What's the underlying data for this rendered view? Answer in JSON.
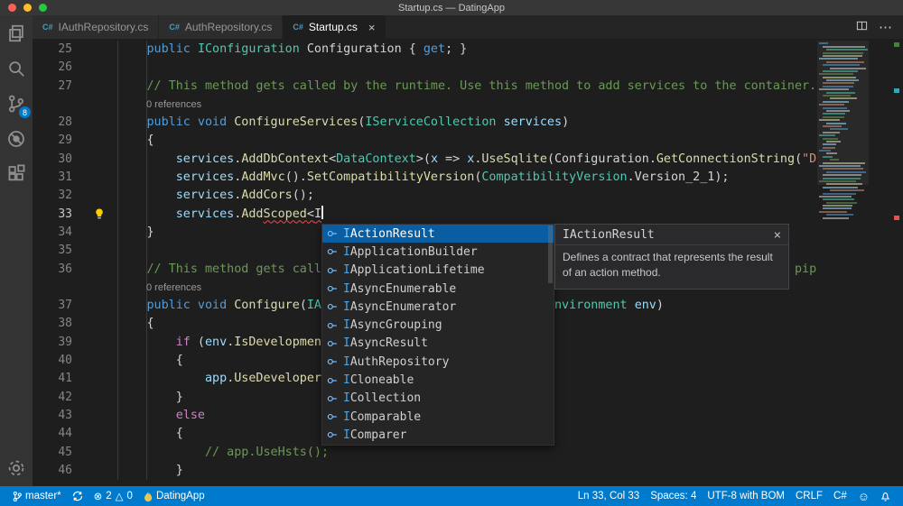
{
  "theme": {
    "accent": "#007acc",
    "editor_bg": "#1e1e1e",
    "panel_bg": "#252526",
    "titlebar_bg": "#373737",
    "activitybar_bg": "#333333",
    "tab_inactive_bg": "#2d2d2d",
    "tab_active_bg": "#1e1e1e",
    "statusbar_bg": "#007acc",
    "error_red": "#f14c4c",
    "selection_blue": "#0b5da2",
    "syn_kw": "#569cd6",
    "syn_type": "#4ec9b0",
    "syn_fn": "#dcdcaa",
    "syn_var": "#9cdcfe",
    "syn_str": "#ce9178",
    "syn_com": "#6a9955",
    "syn_ctrl": "#c586c0",
    "syn_pl": "#d4d4d4"
  },
  "titlebar": {
    "title": "Startup.cs — DatingApp"
  },
  "activity_bar": {
    "scm_badge": "8"
  },
  "tabs": [
    {
      "label": "IAuthRepository.cs",
      "icon": "C#",
      "active": false
    },
    {
      "label": "AuthRepository.cs",
      "icon": "C#",
      "active": false
    },
    {
      "label": "Startup.cs",
      "icon": "C#",
      "active": true,
      "close": "×"
    }
  ],
  "tab_actions": {
    "more": "⋯"
  },
  "editor": {
    "codelens_label": "0 references",
    "rows": [
      {
        "n": "25",
        "segs": [
          [
            "kw",
            "        public "
          ],
          [
            "type",
            "IConfiguration"
          ],
          [
            "pl",
            " Configuration { "
          ],
          [
            "kw",
            "get"
          ],
          [
            "pl",
            "; }"
          ]
        ]
      },
      {
        "n": "26",
        "segs": []
      },
      {
        "n": "27",
        "segs": [
          [
            "com",
            "        // This method gets called by the runtime. Use this method to add services to the container."
          ]
        ]
      },
      {
        "lens": true
      },
      {
        "n": "28",
        "segs": [
          [
            "kw",
            "        public void "
          ],
          [
            "fn",
            "ConfigureServices"
          ],
          [
            "pl",
            "("
          ],
          [
            "type",
            "IServiceCollection"
          ],
          [
            "pl",
            " "
          ],
          [
            "var",
            "services"
          ],
          [
            "pl",
            ")"
          ]
        ]
      },
      {
        "n": "29",
        "segs": [
          [
            "pl",
            "        {"
          ]
        ]
      },
      {
        "n": "30",
        "segs": [
          [
            "var",
            "            services"
          ],
          [
            "pl",
            "."
          ],
          [
            "fn",
            "AddDbContext"
          ],
          [
            "pl",
            "<"
          ],
          [
            "type",
            "DataContext"
          ],
          [
            "pl",
            ">("
          ],
          [
            "var",
            "x"
          ],
          [
            "pl",
            " => "
          ],
          [
            "var",
            "x"
          ],
          [
            "pl",
            "."
          ],
          [
            "fn",
            "UseSqlite"
          ],
          [
            "pl",
            "("
          ],
          [
            "pl",
            "Configuration"
          ],
          [
            "pl",
            "."
          ],
          [
            "fn",
            "GetConnectionString"
          ],
          [
            "pl",
            "("
          ],
          [
            "str",
            "\"De"
          ]
        ]
      },
      {
        "n": "31",
        "segs": [
          [
            "var",
            "            services"
          ],
          [
            "pl",
            "."
          ],
          [
            "fn",
            "AddMvc"
          ],
          [
            "pl",
            "()."
          ],
          [
            "fn",
            "SetCompatibilityVersion"
          ],
          [
            "pl",
            "("
          ],
          [
            "type",
            "CompatibilityVersion"
          ],
          [
            "pl",
            ".Version_2_1);"
          ]
        ]
      },
      {
        "n": "32",
        "segs": [
          [
            "var",
            "            services"
          ],
          [
            "pl",
            "."
          ],
          [
            "fn",
            "AddCors"
          ],
          [
            "pl",
            "();"
          ]
        ]
      },
      {
        "n": "33",
        "cursor": true,
        "bulb": true,
        "segs": [
          [
            "var",
            "            services"
          ],
          [
            "pl",
            "."
          ],
          [
            "fn",
            "Add"
          ],
          [
            "fn",
            "Scoped",
            1
          ],
          [
            "pl",
            "<",
            1
          ],
          [
            "pl",
            "I",
            1
          ]
        ]
      },
      {
        "n": "34",
        "segs": [
          [
            "pl",
            "        }"
          ]
        ]
      },
      {
        "n": "35",
        "segs": []
      },
      {
        "n": "36",
        "segs": [
          [
            "com",
            "        // This method gets called by the runtime. Use this method to configure the HTTP request pipeline."
          ]
        ]
      },
      {
        "lens": true
      },
      {
        "n": "37",
        "segs": [
          [
            "kw",
            "        public void "
          ],
          [
            "fn",
            "Configure"
          ],
          [
            "pl",
            "("
          ],
          [
            "type",
            "IApplicationBuilder"
          ],
          [
            "pl",
            " "
          ],
          [
            "var",
            "app"
          ],
          [
            "pl",
            ", "
          ],
          [
            "type",
            "IHostingEnvironment"
          ],
          [
            "pl",
            " "
          ],
          [
            "var",
            "env"
          ],
          [
            "pl",
            ")"
          ]
        ]
      },
      {
        "n": "38",
        "segs": [
          [
            "pl",
            "        {"
          ]
        ]
      },
      {
        "n": "39",
        "segs": [
          [
            "ctrl",
            "            if"
          ],
          [
            "pl",
            " ("
          ],
          [
            "var",
            "env"
          ],
          [
            "pl",
            "."
          ],
          [
            "fn",
            "IsDevelopment"
          ],
          [
            "pl",
            "())"
          ]
        ]
      },
      {
        "n": "40",
        "segs": [
          [
            "pl",
            "            {"
          ]
        ]
      },
      {
        "n": "41",
        "segs": [
          [
            "var",
            "                app"
          ],
          [
            "pl",
            "."
          ],
          [
            "fn",
            "UseDeveloperExceptionPage"
          ],
          [
            "pl",
            "();"
          ]
        ]
      },
      {
        "n": "42",
        "segs": [
          [
            "pl",
            "            }"
          ]
        ]
      },
      {
        "n": "43",
        "segs": [
          [
            "ctrl",
            "            else"
          ]
        ]
      },
      {
        "n": "44",
        "segs": [
          [
            "pl",
            "            {"
          ]
        ]
      },
      {
        "n": "45",
        "segs": [
          [
            "com",
            "                // app.UseHsts();"
          ]
        ]
      },
      {
        "n": "46",
        "segs": [
          [
            "pl",
            "            }"
          ]
        ]
      }
    ]
  },
  "suggest": {
    "selected_index": 0,
    "items": [
      "IActionResult",
      "IApplicationBuilder",
      "IApplicationLifetime",
      "IAsyncEnumerable",
      "IAsyncEnumerator",
      "IAsyncGrouping",
      "IAsyncResult",
      "IAuthRepository",
      "ICloneable",
      "ICollection",
      "IComparable",
      "IComparer"
    ],
    "docs": {
      "title": "IActionResult",
      "body": "Defines a contract that represents the result of an action method.",
      "close": "×"
    }
  },
  "status_bar": {
    "branch": "master*",
    "error_icon": "⊗",
    "errors": "2",
    "warning_icon": "△",
    "warnings": "0",
    "project": "DatingApp",
    "ln_col": "Ln 33, Col 33",
    "spaces": "Spaces: 4",
    "encoding": "UTF-8 with BOM",
    "eol": "CRLF",
    "language": "C#",
    "smiley": "☺"
  }
}
